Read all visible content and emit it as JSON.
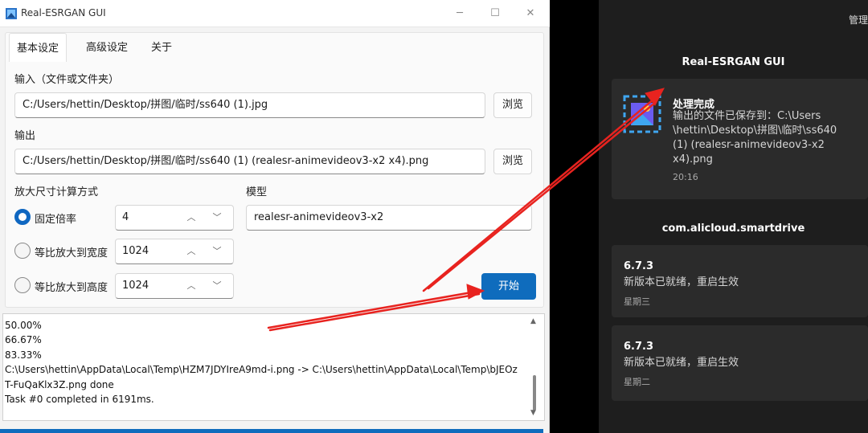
{
  "window": {
    "title": "Real-ESRGAN GUI"
  },
  "tabs": [
    {
      "label": "基本设定",
      "active": true
    },
    {
      "label": "高级设定",
      "active": false
    },
    {
      "label": "关于",
      "active": false
    }
  ],
  "input": {
    "label": "输入（文件或文件夹）",
    "value": "C:/Users/hettin/Desktop/拼图/临时/ss640 (1).jpg",
    "browse_label": "浏览"
  },
  "output": {
    "label": "输出",
    "value": "C:/Users/hettin/Desktop/拼图/临时/ss640 (1) (realesr-animevideov3-x2 x4).png",
    "browse_label": "浏览"
  },
  "scale": {
    "label": "放大尺寸计算方式",
    "options": [
      {
        "label": "固定倍率",
        "value": "4",
        "selected": true
      },
      {
        "label": "等比放大到宽度",
        "value": "1024",
        "selected": false
      },
      {
        "label": "等比放大到高度",
        "value": "1024",
        "selected": false
      }
    ]
  },
  "model": {
    "label": "模型",
    "value": "realesr-animevideov3-x2"
  },
  "start_label": "开始",
  "log_lines": [
    "50.00%",
    "66.67%",
    "83.33%",
    "C:\\Users\\hettin\\AppData\\Local\\Temp\\HZM7JDYIreA9md-i.png -> C:\\Users\\hettin\\AppData\\Local\\Temp\\bJEOz",
    "T-FuQaKlx3Z.png done",
    "Task #0 completed in 6191ms."
  ],
  "notifications": {
    "manage_label": "管理",
    "groups": [
      {
        "app": "Real-ESRGAN GUI",
        "items": [
          {
            "title": "处理完成",
            "body_lines": [
              "输出的文件已保存到：C:\\Users",
              "\\hettin\\Desktop\\拼图\\临时\\ss640",
              "(1) (realesr-animevideov3-x2",
              "x4).png"
            ],
            "time": "20:16",
            "icon": "image-file-icon"
          }
        ]
      },
      {
        "app": "com.alicloud.smartdrive",
        "items": [
          {
            "title": "6.7.3",
            "body": "新版本已就绪，重启生效",
            "time": "星期三"
          },
          {
            "title": "6.7.3",
            "body": "新版本已就绪，重启生效",
            "time": "星期二"
          }
        ]
      }
    ]
  },
  "colors": {
    "accent": "#0f6cbd",
    "annotation_arrow": "#e8231f",
    "notification_bg": "#1e1e1e",
    "card_bg": "#2b2b2b"
  }
}
